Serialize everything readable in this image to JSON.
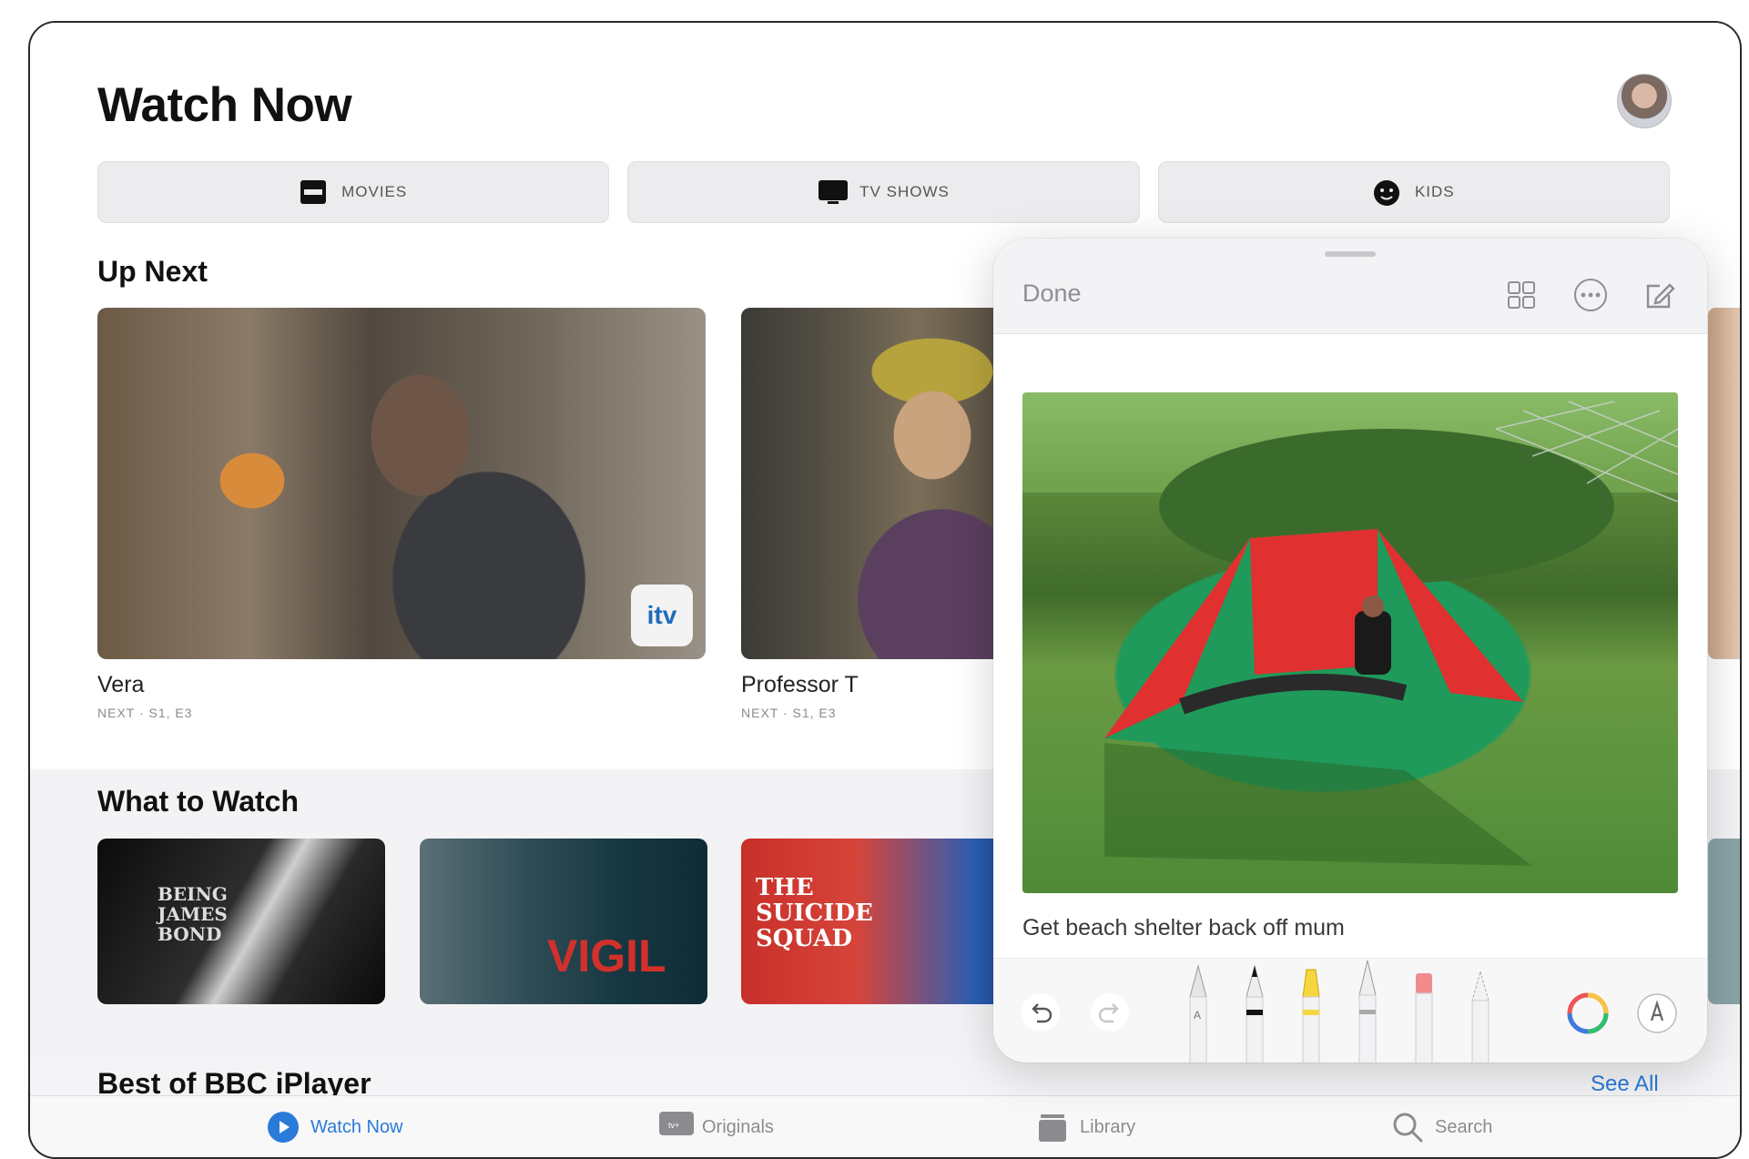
{
  "page": {
    "title": "Watch Now"
  },
  "segments": [
    {
      "label": "MOVIES",
      "icon": "film-icon"
    },
    {
      "label": "TV SHOWS",
      "icon": "tv-icon"
    },
    {
      "label": "KIDS",
      "icon": "kids-face-icon"
    }
  ],
  "up_next": {
    "title": "Up Next",
    "items": [
      {
        "title": "Vera",
        "subtitle": "NEXT · S1, E3",
        "badge": "itv"
      },
      {
        "title": "Professor T",
        "subtitle": "NEXT · S1, E3"
      }
    ]
  },
  "what_to_watch": {
    "title": "What to Watch",
    "items": [
      {
        "poster_text": "BEING JAMES BOND"
      },
      {
        "poster_text": "VIGIL"
      },
      {
        "poster_text": "THE SUICIDE SQUAD"
      }
    ]
  },
  "bbc": {
    "title": "Best of BBC iPlayer",
    "see_all": "See All"
  },
  "tabs": [
    {
      "label": "Watch Now",
      "icon": "play-circle-icon",
      "active": true
    },
    {
      "label": "Originals",
      "icon": "apple-tv-icon",
      "active": false
    },
    {
      "label": "Library",
      "icon": "library-icon",
      "active": false
    },
    {
      "label": "Search",
      "icon": "search-icon",
      "active": false
    }
  ],
  "notes": {
    "done_label": "Done",
    "note_caption": "Get beach shelter back off mum",
    "header_icons": [
      "gallery-grid-icon",
      "more-circle-icon",
      "compose-icon"
    ],
    "tools": [
      "undo-icon",
      "redo-icon",
      "pen-icon",
      "marker-icon",
      "highlighter-icon",
      "pencil-icon",
      "eraser-icon",
      "lasso-icon",
      "color-picker-icon",
      "more-tools-icon"
    ]
  },
  "colors": {
    "accent": "#2a7ad8",
    "tent_red": "#e0302f",
    "tent_green": "#1f9a5a"
  }
}
